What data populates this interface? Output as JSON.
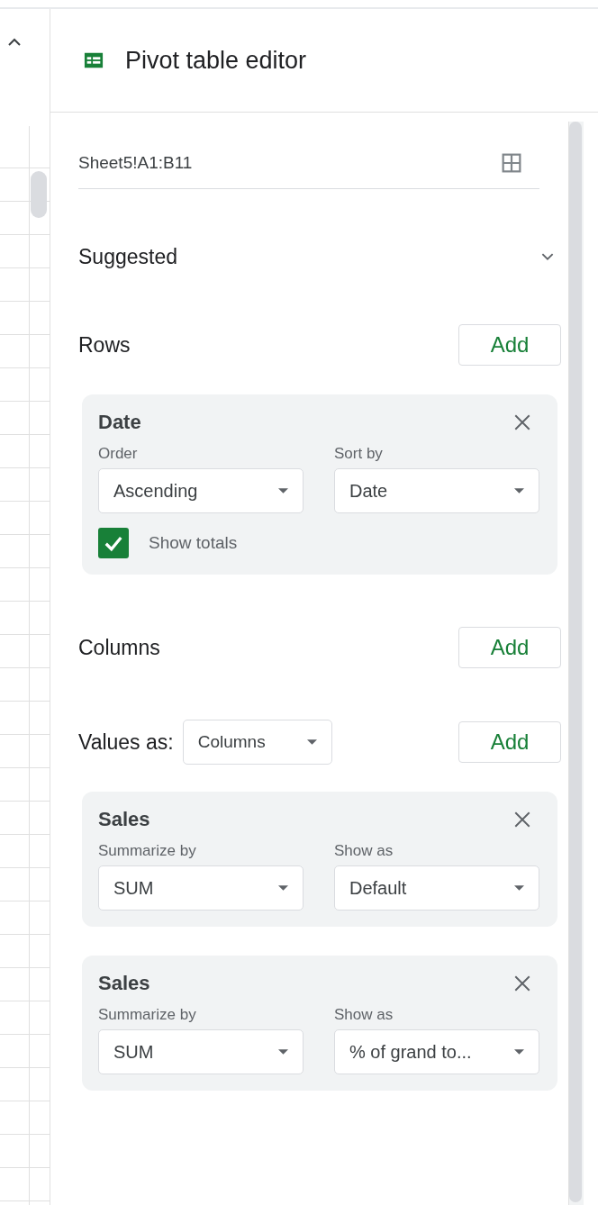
{
  "header": {
    "title": "Pivot table editor"
  },
  "range": {
    "value": "Sheet5!A1:B11"
  },
  "suggested": {
    "label": "Suggested",
    "expanded": false
  },
  "rows": {
    "label": "Rows",
    "add_button": "Add",
    "fields": [
      {
        "name": "Date",
        "controls": [
          {
            "label": "Order",
            "value": "Ascending"
          },
          {
            "label": "Sort by",
            "value": "Date"
          }
        ],
        "show_totals": {
          "label": "Show totals",
          "checked": true
        }
      }
    ]
  },
  "columns": {
    "label": "Columns",
    "add_button": "Add"
  },
  "values": {
    "label": "Values as:",
    "layout": "Columns",
    "add_button": "Add",
    "fields": [
      {
        "name": "Sales",
        "controls": [
          {
            "label": "Summarize by",
            "value": "SUM"
          },
          {
            "label": "Show as",
            "value": "Default"
          }
        ]
      },
      {
        "name": "Sales",
        "controls": [
          {
            "label": "Summarize by",
            "value": "SUM"
          },
          {
            "label": "Show as",
            "value": "% of grand to..."
          }
        ]
      }
    ]
  }
}
